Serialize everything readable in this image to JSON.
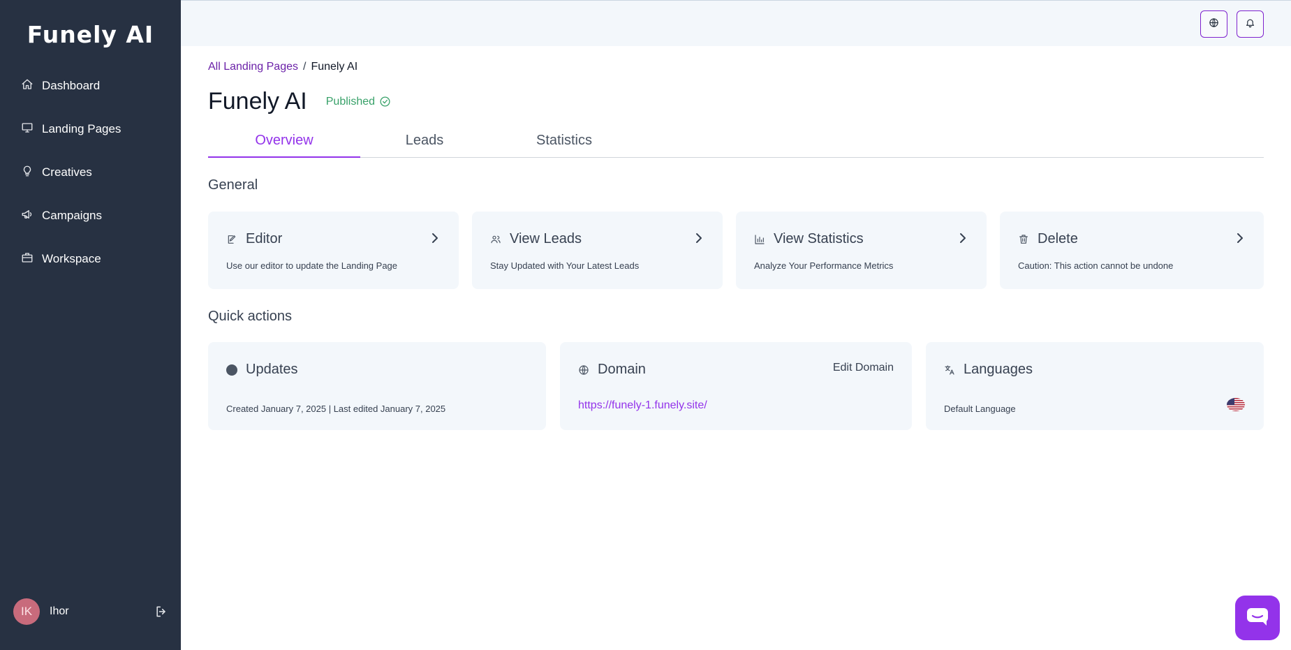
{
  "sidebar": {
    "logo": "Funely AI",
    "items": [
      {
        "label": "Dashboard",
        "icon": "home-icon"
      },
      {
        "label": "Landing Pages",
        "icon": "monitor-icon"
      },
      {
        "label": "Creatives",
        "icon": "lightbulb-icon"
      },
      {
        "label": "Campaigns",
        "icon": "megaphone-icon"
      },
      {
        "label": "Workspace",
        "icon": "briefcase-icon"
      }
    ],
    "user": {
      "initials": "IK",
      "name": "Ihor"
    }
  },
  "header": {
    "buttons": [
      "globe-icon",
      "bell-icon"
    ]
  },
  "breadcrumb": {
    "parent": "All Landing Pages",
    "separator": "/",
    "current": "Funely AI"
  },
  "page": {
    "title": "Funely AI",
    "status": "Published",
    "status_color": "#38a169"
  },
  "tabs": [
    {
      "label": "Overview",
      "active": true
    },
    {
      "label": "Leads",
      "active": false
    },
    {
      "label": "Statistics",
      "active": false
    }
  ],
  "general": {
    "title": "General",
    "cards": [
      {
        "title": "Editor",
        "description": "Use our editor to update the Landing Page",
        "icon": "edit-icon"
      },
      {
        "title": "View Leads",
        "description": "Stay Updated with Your Latest Leads",
        "icon": "users-icon"
      },
      {
        "title": "View Statistics",
        "description": "Analyze Your Performance Metrics",
        "icon": "bar-chart-icon"
      },
      {
        "title": "Delete",
        "description": "Caution: This action cannot be undone",
        "icon": "trash-icon"
      }
    ]
  },
  "quick_actions": {
    "title": "Quick actions",
    "updates": {
      "title": "Updates",
      "text": "Created January 7, 2025 | Last edited January 7, 2025"
    },
    "domain": {
      "title": "Domain",
      "action": "Edit Domain",
      "url": "https://funely-1.funely.site/"
    },
    "languages": {
      "title": "Languages",
      "text": "Default Language",
      "flag": "us-flag-icon"
    }
  },
  "colors": {
    "accent": "#9333ea",
    "sidebar_bg": "#273142",
    "card_bg": "#f3f7fb"
  }
}
